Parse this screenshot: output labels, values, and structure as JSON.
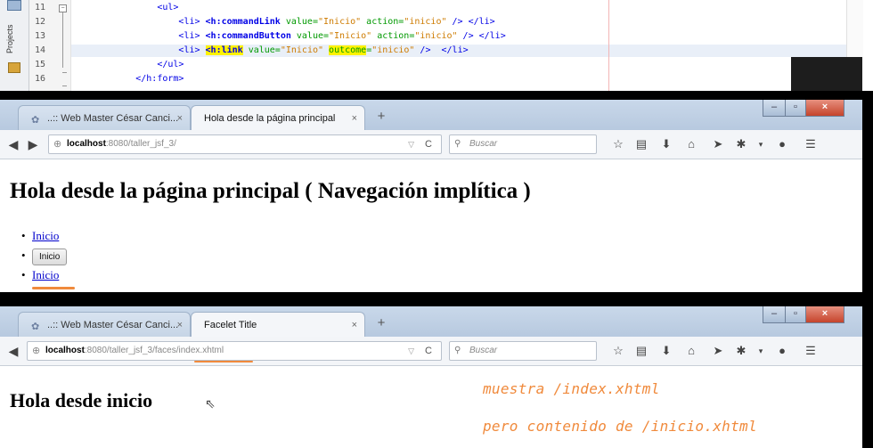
{
  "editor": {
    "side_label": "Projects",
    "line_numbers": [
      "11",
      "12",
      "13",
      "14",
      "15",
      "16"
    ],
    "lines": [
      {
        "indent": "                ",
        "parts": [
          [
            "tag",
            "<ul>"
          ]
        ]
      },
      {
        "indent": "                    ",
        "parts": [
          [
            "tag",
            "<li> "
          ],
          [
            "tagb",
            "<h:commandLink"
          ],
          [
            "attr",
            " value="
          ],
          [
            "str",
            "\"Inicio\""
          ],
          [
            "attr",
            " action="
          ],
          [
            "str",
            "\"inicio\""
          ],
          [
            "tag",
            " /> </li>"
          ]
        ]
      },
      {
        "indent": "                    ",
        "parts": [
          [
            "tag",
            "<li> "
          ],
          [
            "tagb",
            "<h:commandButton"
          ],
          [
            "attr",
            " value="
          ],
          [
            "str",
            "\"Inicio\""
          ],
          [
            "attr",
            " action="
          ],
          [
            "str",
            "\"inicio\""
          ],
          [
            "tag",
            " /> </li>"
          ]
        ]
      },
      {
        "indent": "                    ",
        "parts": [
          [
            "tag",
            "<li> "
          ],
          [
            "tagb mark",
            "<h:link"
          ],
          [
            "attr",
            " value="
          ],
          [
            "str",
            "\"Inicio\""
          ],
          [
            "attr",
            " "
          ],
          [
            "attr mark",
            "outcome"
          ],
          [
            "attr",
            "="
          ],
          [
            "str",
            "\"inicio\""
          ],
          [
            "tag",
            " />  </li>"
          ]
        ]
      },
      {
        "indent": "                ",
        "parts": [
          [
            "tag",
            "</ul>"
          ]
        ]
      },
      {
        "indent": "            ",
        "parts": [
          [
            "tag",
            "</h:form>"
          ]
        ]
      }
    ]
  },
  "browser1": {
    "tabs": [
      {
        "label": "..:: Web Master César Canci...",
        "close": "×"
      },
      {
        "label": "Hola desde la página principal",
        "close": "×"
      }
    ],
    "new_tab": "+",
    "url_host": "localhost",
    "url_path": ":8080/taller_jsf_3/",
    "search_placeholder": "Buscar",
    "heading": "Hola desde la página principal ( Navegación implítica )",
    "links": {
      "command_link": "Inicio",
      "command_button": "Inicio",
      "h_link": "Inicio"
    }
  },
  "browser2": {
    "tabs": [
      {
        "label": "..:: Web Master César Canci...",
        "close": "×"
      },
      {
        "label": "Facelet Title",
        "close": "×"
      }
    ],
    "new_tab": "+",
    "url_host": "localhost",
    "url_path": ":8080/taller_jsf_3/faces/index.xhtml",
    "search_placeholder": "Buscar",
    "heading": "Hola desde inicio"
  },
  "annotations": {
    "note_line1": "muestra /index.xhtml",
    "note_line2": "pero contenido de /inicio.xhtml",
    "color": "#f08a3c"
  },
  "toolbar_icons": [
    "star-icon",
    "bookmarks-icon",
    "download-icon",
    "home-icon",
    "send-icon",
    "addon-icon",
    "menu-dropdown-icon",
    "chat-icon",
    "hamburger-menu-icon"
  ]
}
